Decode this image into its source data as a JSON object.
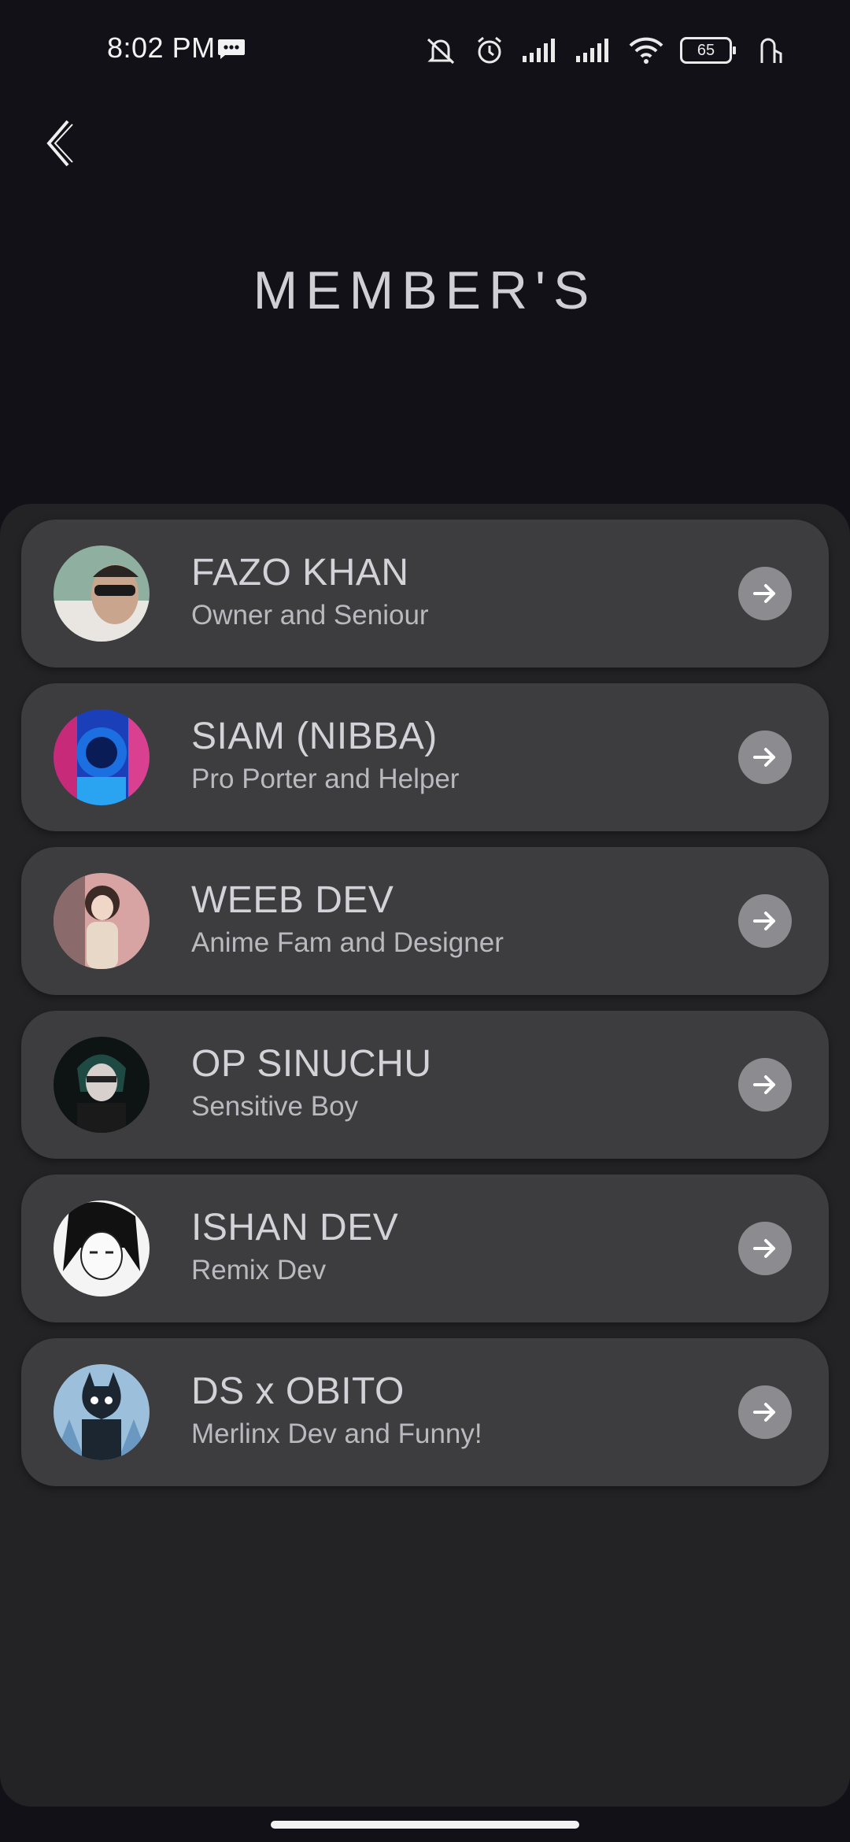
{
  "status_bar": {
    "time": "8:02 PM",
    "battery": "65",
    "icons": [
      "message-icon",
      "silent-icon",
      "alarm-icon",
      "signal-icon",
      "signal-icon",
      "wifi-icon",
      "battery-icon",
      "gesture-icon"
    ]
  },
  "header": {
    "back_icon": "chevron-left-icon",
    "title": "MEMBER'S"
  },
  "members": [
    {
      "name": "FAZO KHAN",
      "role": "Owner and Seniour",
      "avatar_color": "#7a9a8a"
    },
    {
      "name": "SIAM (NIBBA)",
      "role": "Pro Porter and Helper",
      "avatar_color": "#2a5bd7"
    },
    {
      "name": "WEEB DEV",
      "role": "Anime Fam and Designer",
      "avatar_color": "#c98a8a"
    },
    {
      "name": "OP SINUCHU",
      "role": "Sensitive Boy",
      "avatar_color": "#1c2a2a"
    },
    {
      "name": "ISHAN DEV",
      "role": "Remix Dev",
      "avatar_color": "#e8e8e8"
    },
    {
      "name": "DS x OBITO",
      "role": "Merlinx Dev and Funny!",
      "avatar_color": "#8fb4d3"
    }
  ],
  "colors": {
    "background": "#131118",
    "sheet": "#232325",
    "card": "#3d3d3f",
    "arrow_button": "#8c8c90"
  }
}
